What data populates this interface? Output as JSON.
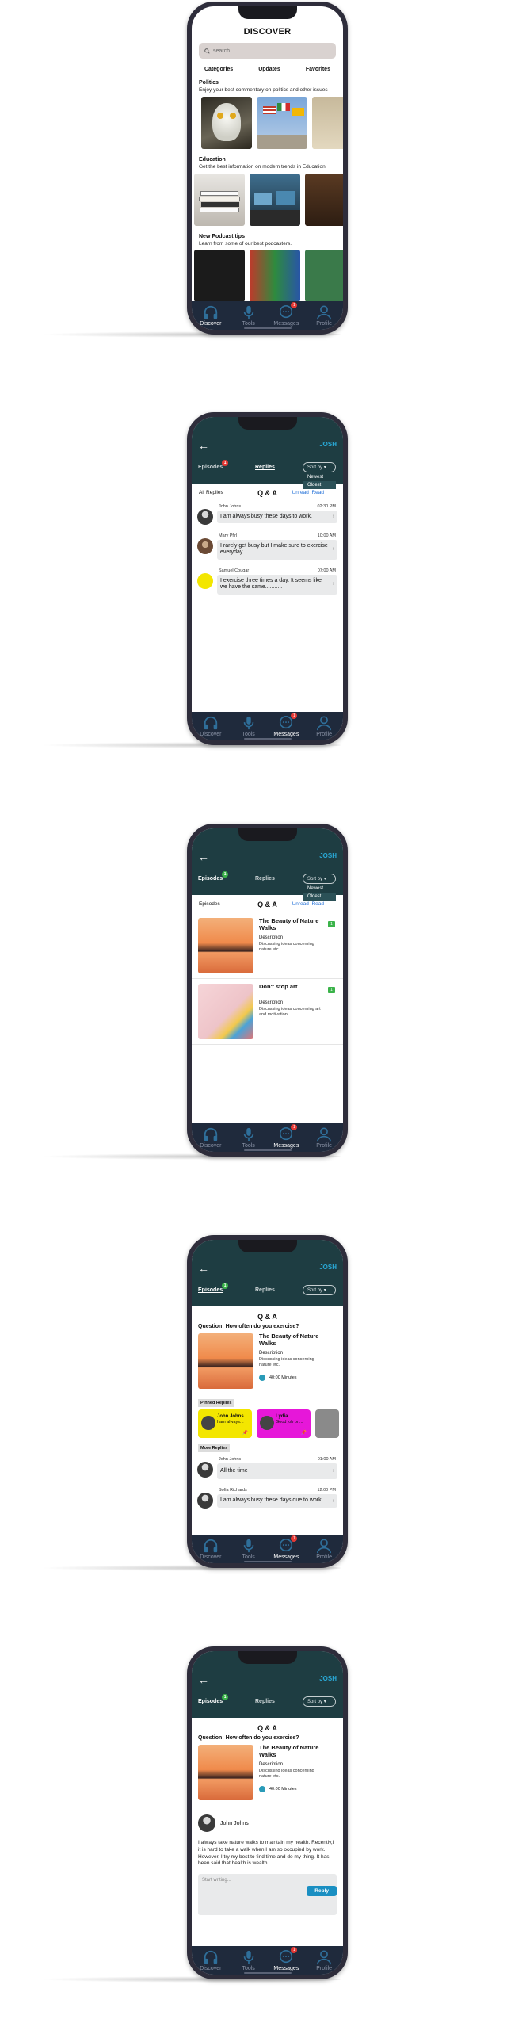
{
  "nav": {
    "discover": "Discover",
    "tools": "Tools",
    "messages": "Messages",
    "profile": "Profile",
    "badge": "1"
  },
  "discover": {
    "title": "DISCOVER",
    "search_placeholder": "search...",
    "tabs": [
      "Categories",
      "Updates",
      "Favorites"
    ],
    "sections": [
      {
        "title": "Politics",
        "desc": "Enjoy your best commentary on politics and other issues"
      },
      {
        "title": "Education",
        "desc": "Get the best information on modern trends in Education"
      },
      {
        "title": "New  Podcast tips",
        "desc": "Learn from some of our best podcasters."
      }
    ]
  },
  "header": {
    "back": "←",
    "user": "JOSH",
    "tab_episodes": "Episodes",
    "tab_replies": "Replies",
    "badge": "1",
    "sort_label": "Sort by",
    "sort_options": [
      "Newest",
      "Oldest"
    ]
  },
  "replies_screen": {
    "filter_label": "All Replies",
    "qa_label": "Q & A",
    "unread": "Unread",
    "read": "Read",
    "items": [
      {
        "name": "John Johns",
        "time": "02:30 PM",
        "text": "I am always busy these days to work."
      },
      {
        "name": "Mary Pfirl",
        "time": "10:00 AM",
        "text": "I rarely get busy but I make sure to exercise everyday."
      },
      {
        "name": "Samuel Cougar",
        "time": "07:00 AM",
        "text": "I exercise three times a day. It seems like we have the same..........."
      }
    ]
  },
  "episodes_screen": {
    "filter_label": "Episodes",
    "qa_label": "Q & A",
    "unread": "Unread",
    "read": "Read",
    "episodes": [
      {
        "title": "The Beauty of Nature Walks",
        "desc_label": "Description",
        "desc": "Discussing ideas concerning nature etc.",
        "badge": "1"
      },
      {
        "title": "Don't stop art",
        "desc_label": "Description",
        "desc": "Discussing ideas concerning art and motivation",
        "badge": "1"
      }
    ]
  },
  "question_screen": {
    "title": "Q & A",
    "question": "Question: How often do you exercise?",
    "episode_title": "The Beauty of Nature Walks",
    "desc_label": "Description",
    "desc": "Discussing ideas concerning nature etc.",
    "duration": "40:00 Minutes",
    "pinned_label": "Pinned Replies",
    "pinned": [
      {
        "name": "John Johns",
        "text": "I am always..."
      },
      {
        "name": "Lydia",
        "text": "Good job on..."
      }
    ],
    "more_label": "More Replies",
    "more": [
      {
        "name": "John Johns",
        "time": "01:00 AM",
        "text": "All the time"
      },
      {
        "name": "Sofia Richards",
        "time": "12:00 PM",
        "text": "I am always busy these days due to work."
      }
    ]
  },
  "detail_screen": {
    "title": "Q & A",
    "question": "Question: How often do you exercise?",
    "episode_title": "The Beauty of Nature Walks",
    "desc_label": "Description",
    "desc": "Discussing ideas concerning nature etc.",
    "duration": "40:00 Minutes",
    "author": "John Johns",
    "body": "I always take nature walks to maintain my health. Recently,I it is hard to take a walk when I am so occupied by work. However, I try my best to find time and do my thing. It has been said that health is wealth.",
    "input_placeholder": "Start writing...",
    "reply_button": "Reply"
  }
}
